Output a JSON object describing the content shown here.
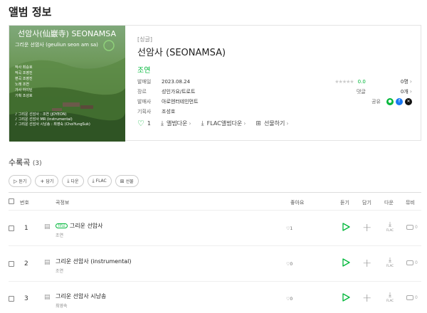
{
  "page": {
    "title": "앨범 정보"
  },
  "album": {
    "cover_title": "선암사(仙巖寺) SEONAMSA",
    "cover_subtitle": "그리운 선암사 (geuliun seon am sa)",
    "cover_lines": [
      "작사 최승호",
      "작곡 조영진",
      "편곡 조영진",
      "노래 조연",
      "가사 하이틴",
      "기획 조성호"
    ],
    "cover_credits": [
      "♪ 그리운 선암사 : 조연 (JOYEON)",
      "♪ 그리운 선암사 MR (instrumental)",
      "♪ 그리운 선암사 시낭송 : 최영숙 (ChoiYungSuk)"
    ],
    "type_tag": "[싱글]",
    "name": "선암사 (SEONAMSA)",
    "artist": "조연",
    "meta": [
      {
        "key": "발매일",
        "value": "2023.08.24"
      },
      {
        "key": "장르",
        "value": "성인가요/트로트"
      },
      {
        "key": "발매사",
        "value": "아로엔터테인먼트"
      },
      {
        "key": "기획사",
        "value": "조성호"
      }
    ],
    "rating": {
      "stars": "★★★★★",
      "score": "0.0",
      "count": "0명"
    },
    "comments": {
      "label": "댓글",
      "count": "0개"
    },
    "share_label": "공유",
    "likes": "1",
    "actions": {
      "album_download": "앨범다운",
      "flac_download": "FLAC앨범다운",
      "gift": "선물하기"
    }
  },
  "tracklist": {
    "title": "수록곡",
    "count": "(3)",
    "buttons": {
      "listen": "듣기",
      "add": "담기",
      "download": "다운",
      "flac": "FLAC",
      "gift": "선물"
    },
    "headers": {
      "number": "번호",
      "song_info": "곡정보",
      "likes": "좋아요",
      "listen": "듣기",
      "add": "담기",
      "download": "다운",
      "mv": "뮤비"
    },
    "title_badge": "TITLE",
    "flac_label": "FLAC",
    "rows": [
      {
        "number": "1",
        "title": "그리운 선암사",
        "artist": "조연",
        "likes": "1",
        "mv": "0"
      },
      {
        "number": "2",
        "title": "그리운 선암사 (instrumental)",
        "artist": "조연",
        "likes": "0",
        "mv": "0"
      },
      {
        "number": "3",
        "title": "그리운 선암사 시낭송",
        "artist": "최영숙",
        "likes": "0",
        "mv": "0"
      }
    ]
  },
  "colors": {
    "accent": "#00b73a",
    "border": "#e4e4e4",
    "text": "#333333"
  }
}
